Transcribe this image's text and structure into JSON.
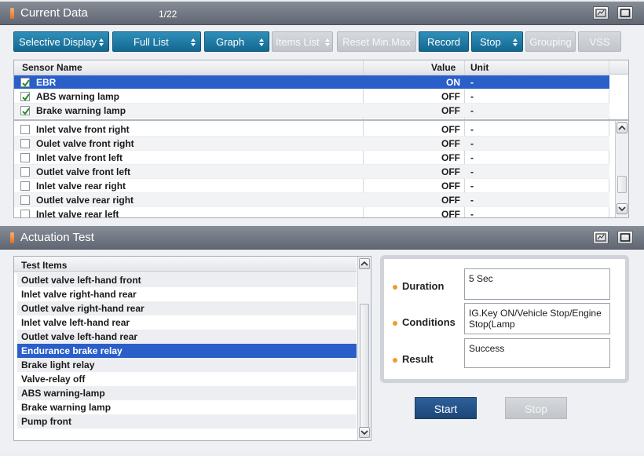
{
  "current_data": {
    "title": "Current Data",
    "page_counter": "1/22",
    "toolbar": [
      {
        "label": "Selective Display",
        "has_spinner": true,
        "enabled": true
      },
      {
        "label": "Full List",
        "has_spinner": true,
        "enabled": true
      },
      {
        "label": "Graph",
        "has_spinner": true,
        "enabled": true
      },
      {
        "label": "Items List",
        "has_spinner": true,
        "enabled": false
      },
      {
        "label": "Reset Min.Max",
        "has_spinner": false,
        "enabled": false
      },
      {
        "label": "Record",
        "has_spinner": false,
        "enabled": true
      },
      {
        "label": "Stop",
        "has_spinner": true,
        "enabled": true
      },
      {
        "label": "Grouping",
        "has_spinner": false,
        "enabled": false
      },
      {
        "label": "VSS",
        "has_spinner": false,
        "enabled": false
      }
    ],
    "columns": {
      "name": "Sensor Name",
      "value": "Value",
      "unit": "Unit"
    },
    "fixed_rows": [
      {
        "name": "EBR",
        "value": "ON",
        "unit": "-",
        "checked": true,
        "selected": true
      },
      {
        "name": "ABS warning lamp",
        "value": "OFF",
        "unit": "-",
        "checked": true,
        "selected": false
      },
      {
        "name": "Brake warning lamp",
        "value": "OFF",
        "unit": "-",
        "checked": true,
        "selected": false
      }
    ],
    "rows": [
      {
        "name": "Inlet valve front right",
        "value": "OFF",
        "unit": "-",
        "checked": false
      },
      {
        "name": "Oulet valve front right",
        "value": "OFF",
        "unit": "-",
        "checked": false
      },
      {
        "name": "Inlet valve front left",
        "value": "OFF",
        "unit": "-",
        "checked": false
      },
      {
        "name": "Outlet valve front left",
        "value": "OFF",
        "unit": "-",
        "checked": false
      },
      {
        "name": "Inlet valve rear right",
        "value": "OFF",
        "unit": "-",
        "checked": false
      },
      {
        "name": "Outlet valve rear right",
        "value": "OFF",
        "unit": "-",
        "checked": false
      },
      {
        "name": "Inlet valve rear left",
        "value": "OFF",
        "unit": "-",
        "checked": false
      }
    ]
  },
  "actuation_test": {
    "title": "Actuation Test",
    "list_header": "Test Items",
    "items": [
      {
        "label": "Outlet valve left-hand front",
        "selected": false
      },
      {
        "label": "Inlet valve right-hand rear",
        "selected": false
      },
      {
        "label": "Outlet valve right-hand rear",
        "selected": false
      },
      {
        "label": "Inlet valve left-hand rear",
        "selected": false
      },
      {
        "label": "Outlet valve left-hand rear",
        "selected": false
      },
      {
        "label": "Endurance brake relay",
        "selected": true
      },
      {
        "label": "Brake light relay",
        "selected": false
      },
      {
        "label": "Valve-relay off",
        "selected": false
      },
      {
        "label": "ABS warning-lamp",
        "selected": false
      },
      {
        "label": "Brake warning lamp",
        "selected": false
      },
      {
        "label": "Pump front",
        "selected": false
      }
    ],
    "duration_label": "Duration",
    "duration_value": "5 Sec",
    "conditions_label": "Conditions",
    "conditions_value": "IG.Key ON/Vehicle Stop/Engine Stop(Lamp",
    "result_label": "Result",
    "result_value": "Success",
    "start_label": "Start",
    "stop_label": "Stop"
  },
  "colors": {
    "title_bar": "#6f7580",
    "button_blue": "#1f7aa6",
    "selection": "#2a5fc9",
    "marker_orange": "#f39a2c"
  }
}
